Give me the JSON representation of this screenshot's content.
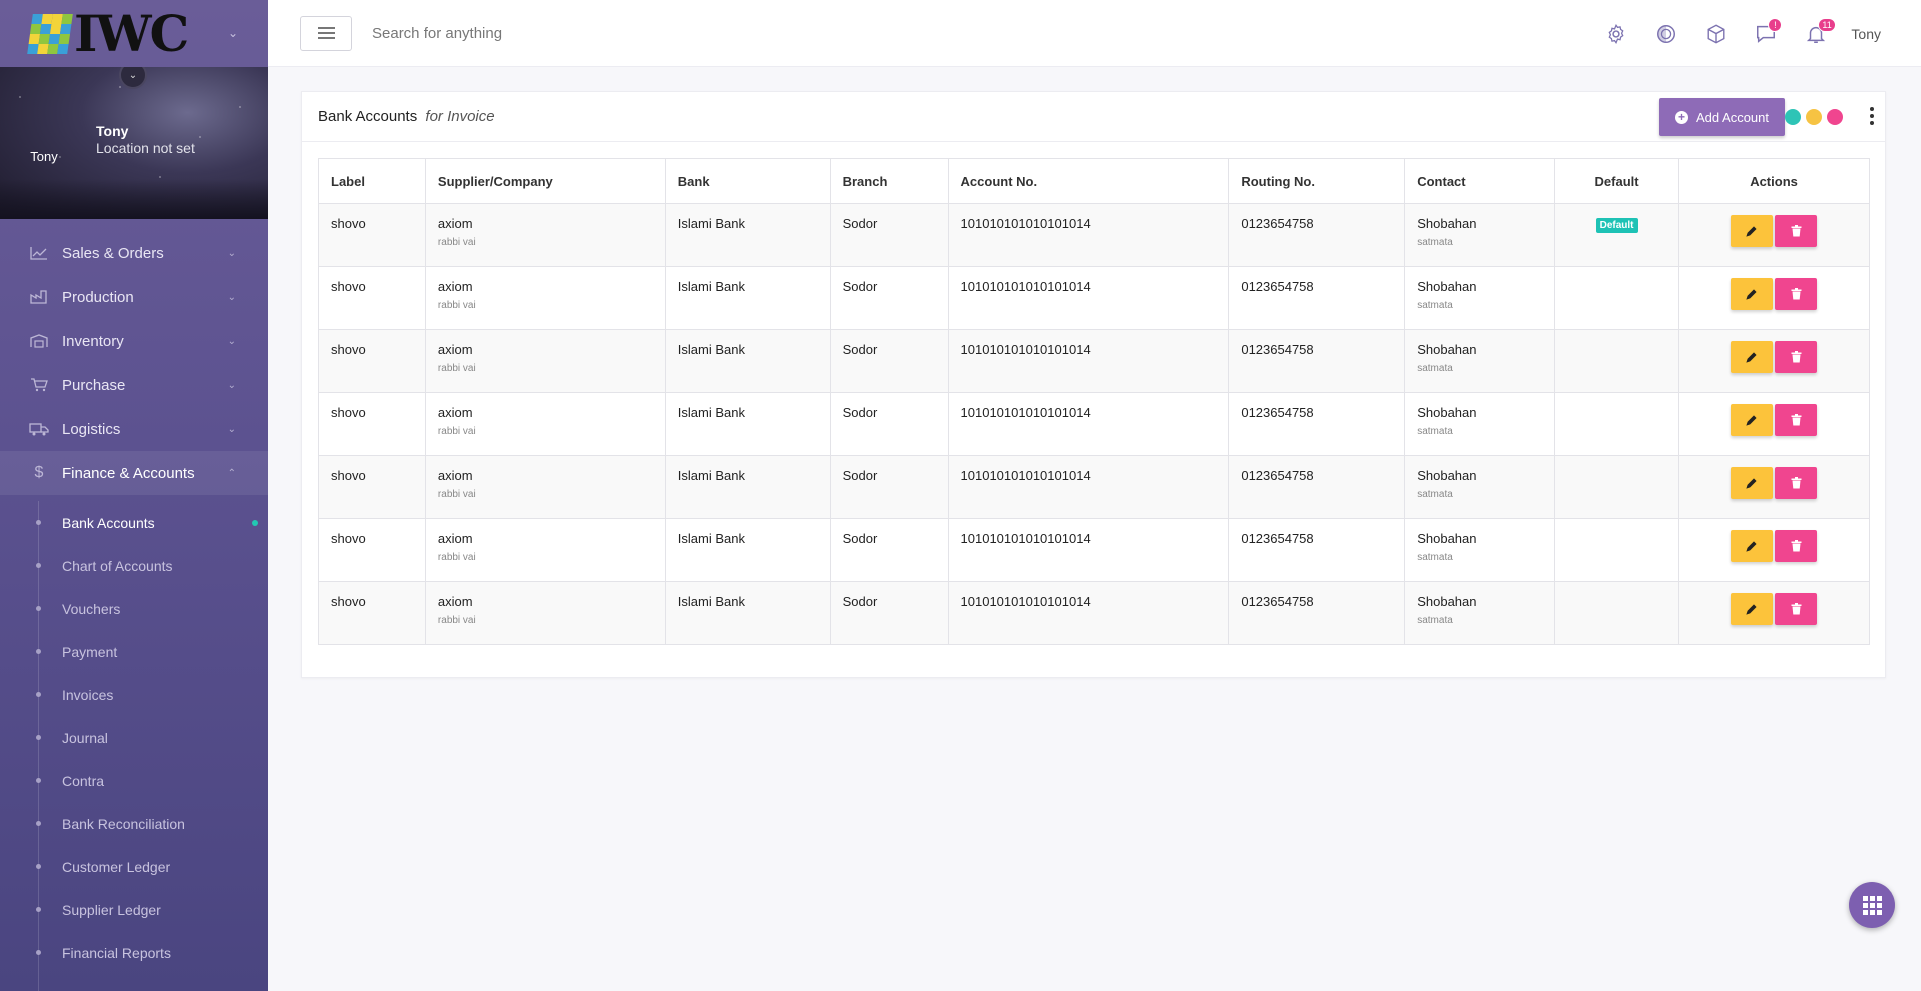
{
  "brand": {
    "name": "IWC"
  },
  "profile": {
    "avatar_text": "Tony",
    "name": "Tony",
    "location": "Location not set"
  },
  "sidebar": {
    "items": [
      {
        "label": "Sales & Orders"
      },
      {
        "label": "Production"
      },
      {
        "label": "Inventory"
      },
      {
        "label": "Purchase"
      },
      {
        "label": "Logistics"
      },
      {
        "label": "Finance & Accounts"
      }
    ],
    "finance_sub": [
      {
        "label": "Bank Accounts"
      },
      {
        "label": "Chart of Accounts"
      },
      {
        "label": "Vouchers"
      },
      {
        "label": "Payment"
      },
      {
        "label": "Invoices"
      },
      {
        "label": "Journal"
      },
      {
        "label": "Contra"
      },
      {
        "label": "Bank Reconciliation"
      },
      {
        "label": "Customer Ledger"
      },
      {
        "label": "Supplier Ledger"
      },
      {
        "label": "Financial Reports"
      }
    ]
  },
  "topbar": {
    "search_placeholder": "Search for anything",
    "messages_badge": "!",
    "notifications_badge": "11",
    "user": "Tony"
  },
  "card": {
    "title": "Bank Accounts",
    "title_suffix": "for Invoice",
    "add_button": "Add Account",
    "theme_dots": [
      "#2ec4b6",
      "#f6c343",
      "#f0458f"
    ]
  },
  "table": {
    "headers": [
      "Label",
      "Supplier/Company",
      "Bank",
      "Branch",
      "Account No.",
      "Routing No.",
      "Contact",
      "Default",
      "Actions"
    ],
    "rows": [
      {
        "label": "shovo",
        "supplier": "axiom",
        "supplier_sub": "rabbi vai",
        "bank": "Islami Bank",
        "branch": "Sodor",
        "account": "101010101010101014",
        "routing": "0123654758",
        "contact": "Shobahan",
        "contact_sub": "satmata",
        "default": "Default"
      },
      {
        "label": "shovo",
        "supplier": "axiom",
        "supplier_sub": "rabbi vai",
        "bank": "Islami Bank",
        "branch": "Sodor",
        "account": "101010101010101014",
        "routing": "0123654758",
        "contact": "Shobahan",
        "contact_sub": "satmata",
        "default": ""
      },
      {
        "label": "shovo",
        "supplier": "axiom",
        "supplier_sub": "rabbi vai",
        "bank": "Islami Bank",
        "branch": "Sodor",
        "account": "101010101010101014",
        "routing": "0123654758",
        "contact": "Shobahan",
        "contact_sub": "satmata",
        "default": ""
      },
      {
        "label": "shovo",
        "supplier": "axiom",
        "supplier_sub": "rabbi vai",
        "bank": "Islami Bank",
        "branch": "Sodor",
        "account": "101010101010101014",
        "routing": "0123654758",
        "contact": "Shobahan",
        "contact_sub": "satmata",
        "default": ""
      },
      {
        "label": "shovo",
        "supplier": "axiom",
        "supplier_sub": "rabbi vai",
        "bank": "Islami Bank",
        "branch": "Sodor",
        "account": "101010101010101014",
        "routing": "0123654758",
        "contact": "Shobahan",
        "contact_sub": "satmata",
        "default": ""
      },
      {
        "label": "shovo",
        "supplier": "axiom",
        "supplier_sub": "rabbi vai",
        "bank": "Islami Bank",
        "branch": "Sodor",
        "account": "101010101010101014",
        "routing": "0123654758",
        "contact": "Shobahan",
        "contact_sub": "satmata",
        "default": ""
      },
      {
        "label": "shovo",
        "supplier": "axiom",
        "supplier_sub": "rabbi vai",
        "bank": "Islami Bank",
        "branch": "Sodor",
        "account": "101010101010101014",
        "routing": "0123654758",
        "contact": "Shobahan",
        "contact_sub": "satmata",
        "default": ""
      }
    ]
  },
  "icons": {
    "settings": "gear-icon",
    "theme": "contrast-icon",
    "apps": "cube-icon",
    "messages": "message-icon",
    "notifications": "bell-icon",
    "edit": "pencil-icon",
    "delete": "trash-icon",
    "fab": "grid-icon"
  }
}
